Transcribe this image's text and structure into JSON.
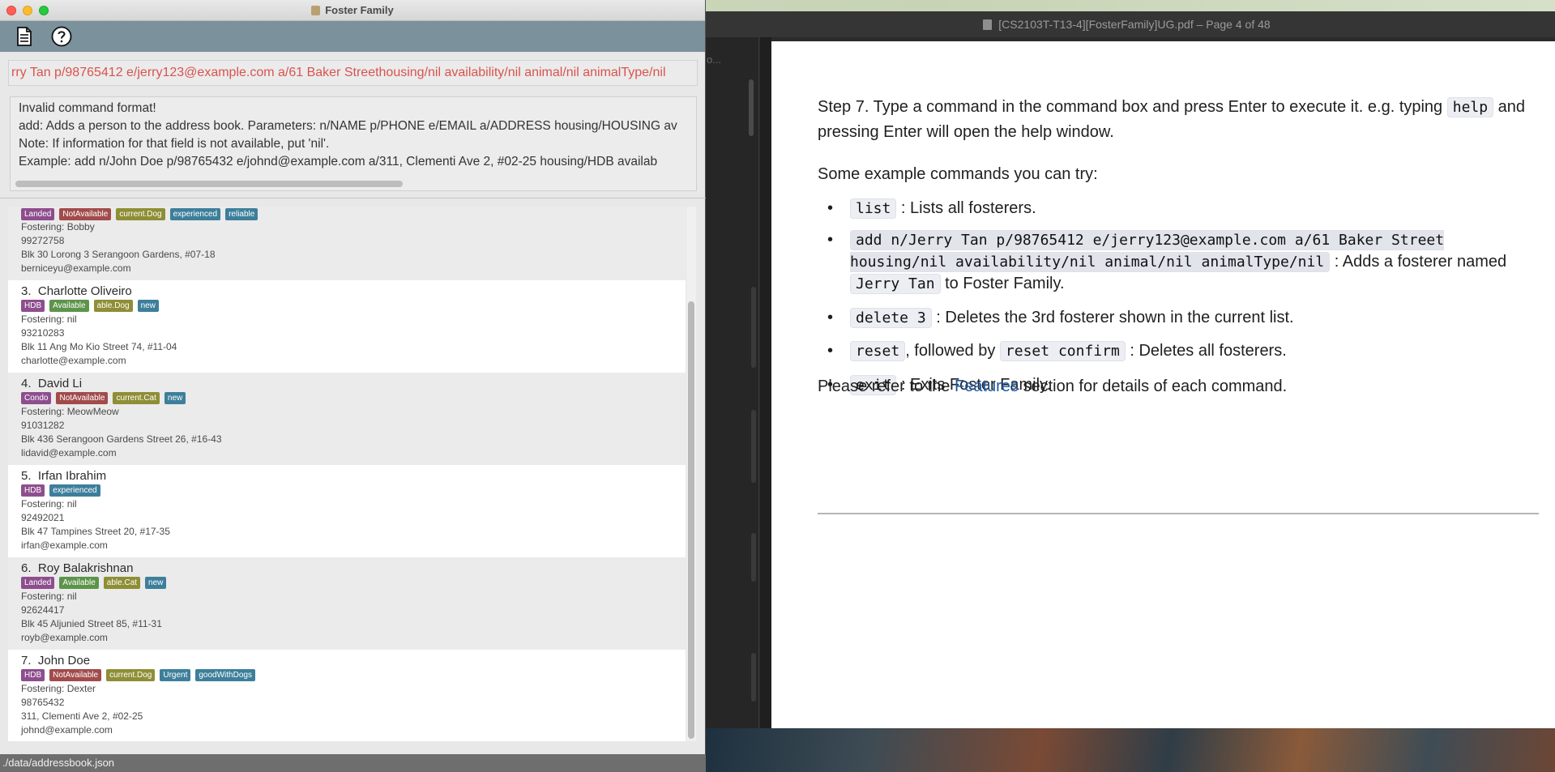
{
  "pdf": {
    "title": "[CS2103T-T13-4][FosterFamily]UG.pdf – Page 4 of 48",
    "sidebar_label": "o...",
    "step7": {
      "before": "Step 7. Type a command in the command box and press Enter to execute it. e.g. typing ",
      "code": "help",
      "after": " and pressing Enter will open the help window."
    },
    "examples_intro": "Some example commands you can try:",
    "bullets": [
      {
        "code": "list",
        "text": " : Lists all fosterers."
      },
      {
        "code": "add n/Jerry Tan p/98765412 e/jerry123@example.com a/61 Baker Street housing/nil availability/nil animal/nil animalType/nil",
        "text": " : Adds a fosterer named ",
        "code2": "Jerry Tan",
        "text2": " to Foster Family."
      },
      {
        "code": "delete 3",
        "text": " : Deletes the 3rd fosterer shown in the current list."
      },
      {
        "code": "reset",
        "text": ", followed by ",
        "code2": "reset confirm",
        "text2": " : Deletes all fosterers."
      },
      {
        "code": "exit",
        "text": " : Exits Foster Family."
      }
    ],
    "refer": {
      "before": "Please refer to the ",
      "link": "Features",
      "after": " section for details of each command."
    }
  },
  "app": {
    "title": "Foster Family",
    "toolbar": {
      "file_icon": "document-icon",
      "help_icon": "help-icon"
    },
    "command": "rry Tan p/98765412 e/jerry123@example.com a/61 Baker Streethousing/nil availability/nil animal/nil animalType/nil",
    "result": [
      "Invalid command format!",
      "add: Adds a person to the address book. Parameters: n/NAME p/PHONE e/EMAIL a/ADDRESS housing/HOUSING av",
      "Note: If information for that field is not available, put 'nil'.",
      "Example: add n/John Doe p/98765432 e/johnd@example.com a/311, Clementi Ave 2, #02-25 housing/HDB availab"
    ],
    "persons": [
      {
        "index": "",
        "name": "",
        "tags": [
          {
            "label": "Landed",
            "color": "#8e4e8e"
          },
          {
            "label": "NotAvailable",
            "color": "#a24b4b"
          },
          {
            "label": "current.Dog",
            "color": "#8e8e36"
          },
          {
            "label": "experienced",
            "color": "#3d7f9b"
          },
          {
            "label": "reliable",
            "color": "#3d7f9b"
          }
        ],
        "fostering": "Fostering: Bobby",
        "phone": "99272758",
        "address": "Blk 30 Lorong 3 Serangoon Gardens, #07-18",
        "email": "berniceyu@example.com"
      },
      {
        "index": "3.",
        "name": "Charlotte Oliveiro",
        "tags": [
          {
            "label": "HDB",
            "color": "#8e4e8e"
          },
          {
            "label": "Available",
            "color": "#5c944a"
          },
          {
            "label": "able.Dog",
            "color": "#8e8e36"
          },
          {
            "label": "new",
            "color": "#3d7f9b"
          }
        ],
        "fostering": "Fostering: nil",
        "phone": "93210283",
        "address": "Blk 11 Ang Mo Kio Street 74, #11-04",
        "email": "charlotte@example.com"
      },
      {
        "index": "4.",
        "name": "David Li",
        "tags": [
          {
            "label": "Condo",
            "color": "#8e4e8e"
          },
          {
            "label": "NotAvailable",
            "color": "#a24b4b"
          },
          {
            "label": "current.Cat",
            "color": "#8e8e36"
          },
          {
            "label": "new",
            "color": "#3d7f9b"
          }
        ],
        "fostering": "Fostering: MeowMeow",
        "phone": "91031282",
        "address": "Blk 436 Serangoon Gardens Street 26, #16-43",
        "email": "lidavid@example.com"
      },
      {
        "index": "5.",
        "name": "Irfan Ibrahim",
        "tags": [
          {
            "label": "HDB",
            "color": "#8e4e8e"
          },
          {
            "label": "experienced",
            "color": "#3d7f9b"
          }
        ],
        "fostering": "Fostering: nil",
        "phone": "92492021",
        "address": "Blk 47 Tampines Street 20, #17-35",
        "email": "irfan@example.com"
      },
      {
        "index": "6.",
        "name": "Roy Balakrishnan",
        "tags": [
          {
            "label": "Landed",
            "color": "#8e4e8e"
          },
          {
            "label": "Available",
            "color": "#5c944a"
          },
          {
            "label": "able.Cat",
            "color": "#8e8e36"
          },
          {
            "label": "new",
            "color": "#3d7f9b"
          }
        ],
        "fostering": "Fostering: nil",
        "phone": "92624417",
        "address": "Blk 45 Aljunied Street 85, #11-31",
        "email": "royb@example.com"
      },
      {
        "index": "7.",
        "name": "John Doe",
        "tags": [
          {
            "label": "HDB",
            "color": "#8e4e8e"
          },
          {
            "label": "NotAvailable",
            "color": "#a24b4b"
          },
          {
            "label": "current.Dog",
            "color": "#8e8e36"
          },
          {
            "label": "Urgent",
            "color": "#3d7f9b"
          },
          {
            "label": "goodWithDogs",
            "color": "#3d7f9b"
          }
        ],
        "fostering": "Fostering: Dexter",
        "phone": "98765432",
        "address": "311, Clementi Ave 2, #02-25",
        "email": "johnd@example.com"
      }
    ],
    "status_bar": "./data/addressbook.json"
  }
}
